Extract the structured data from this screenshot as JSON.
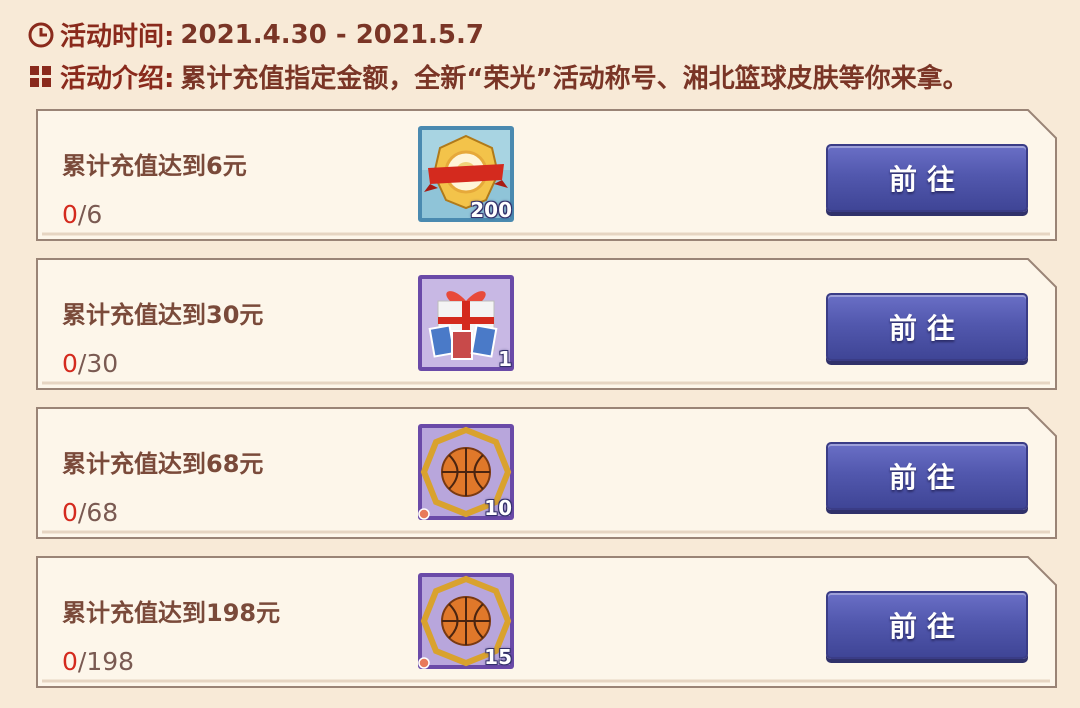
{
  "header": {
    "time_label": "活动时间:",
    "time_value": "2021.4.30 - 2021.5.7",
    "intro_label": "活动介绍:",
    "intro_value": "累计充值指定金额，全新“荣光”活动称号、湘北篮球皮肤等你来拿。"
  },
  "tasks": [
    {
      "title": "累计充值达到6元",
      "current": "0",
      "target": "/6",
      "reward_icon": "title-badge-icon",
      "reward_qty": "200",
      "button": "前往"
    },
    {
      "title": "累计充值达到30元",
      "current": "0",
      "target": "/30",
      "reward_icon": "gift-pack-cards-icon",
      "reward_qty": "1",
      "button": "前往"
    },
    {
      "title": "累计充值达到68元",
      "current": "0",
      "target": "/68",
      "reward_icon": "golden-basketball-icon",
      "reward_qty": "10",
      "button": "前往"
    },
    {
      "title": "累计充值达到198元",
      "current": "0",
      "target": "/198",
      "reward_icon": "golden-basketball-icon",
      "reward_qty": "15",
      "button": "前往"
    }
  ],
  "colors": {
    "background": "#f8ead7",
    "accent_red": "#d42a1e",
    "button_blue": "#5258ae",
    "label_red": "#8a2a1c"
  }
}
